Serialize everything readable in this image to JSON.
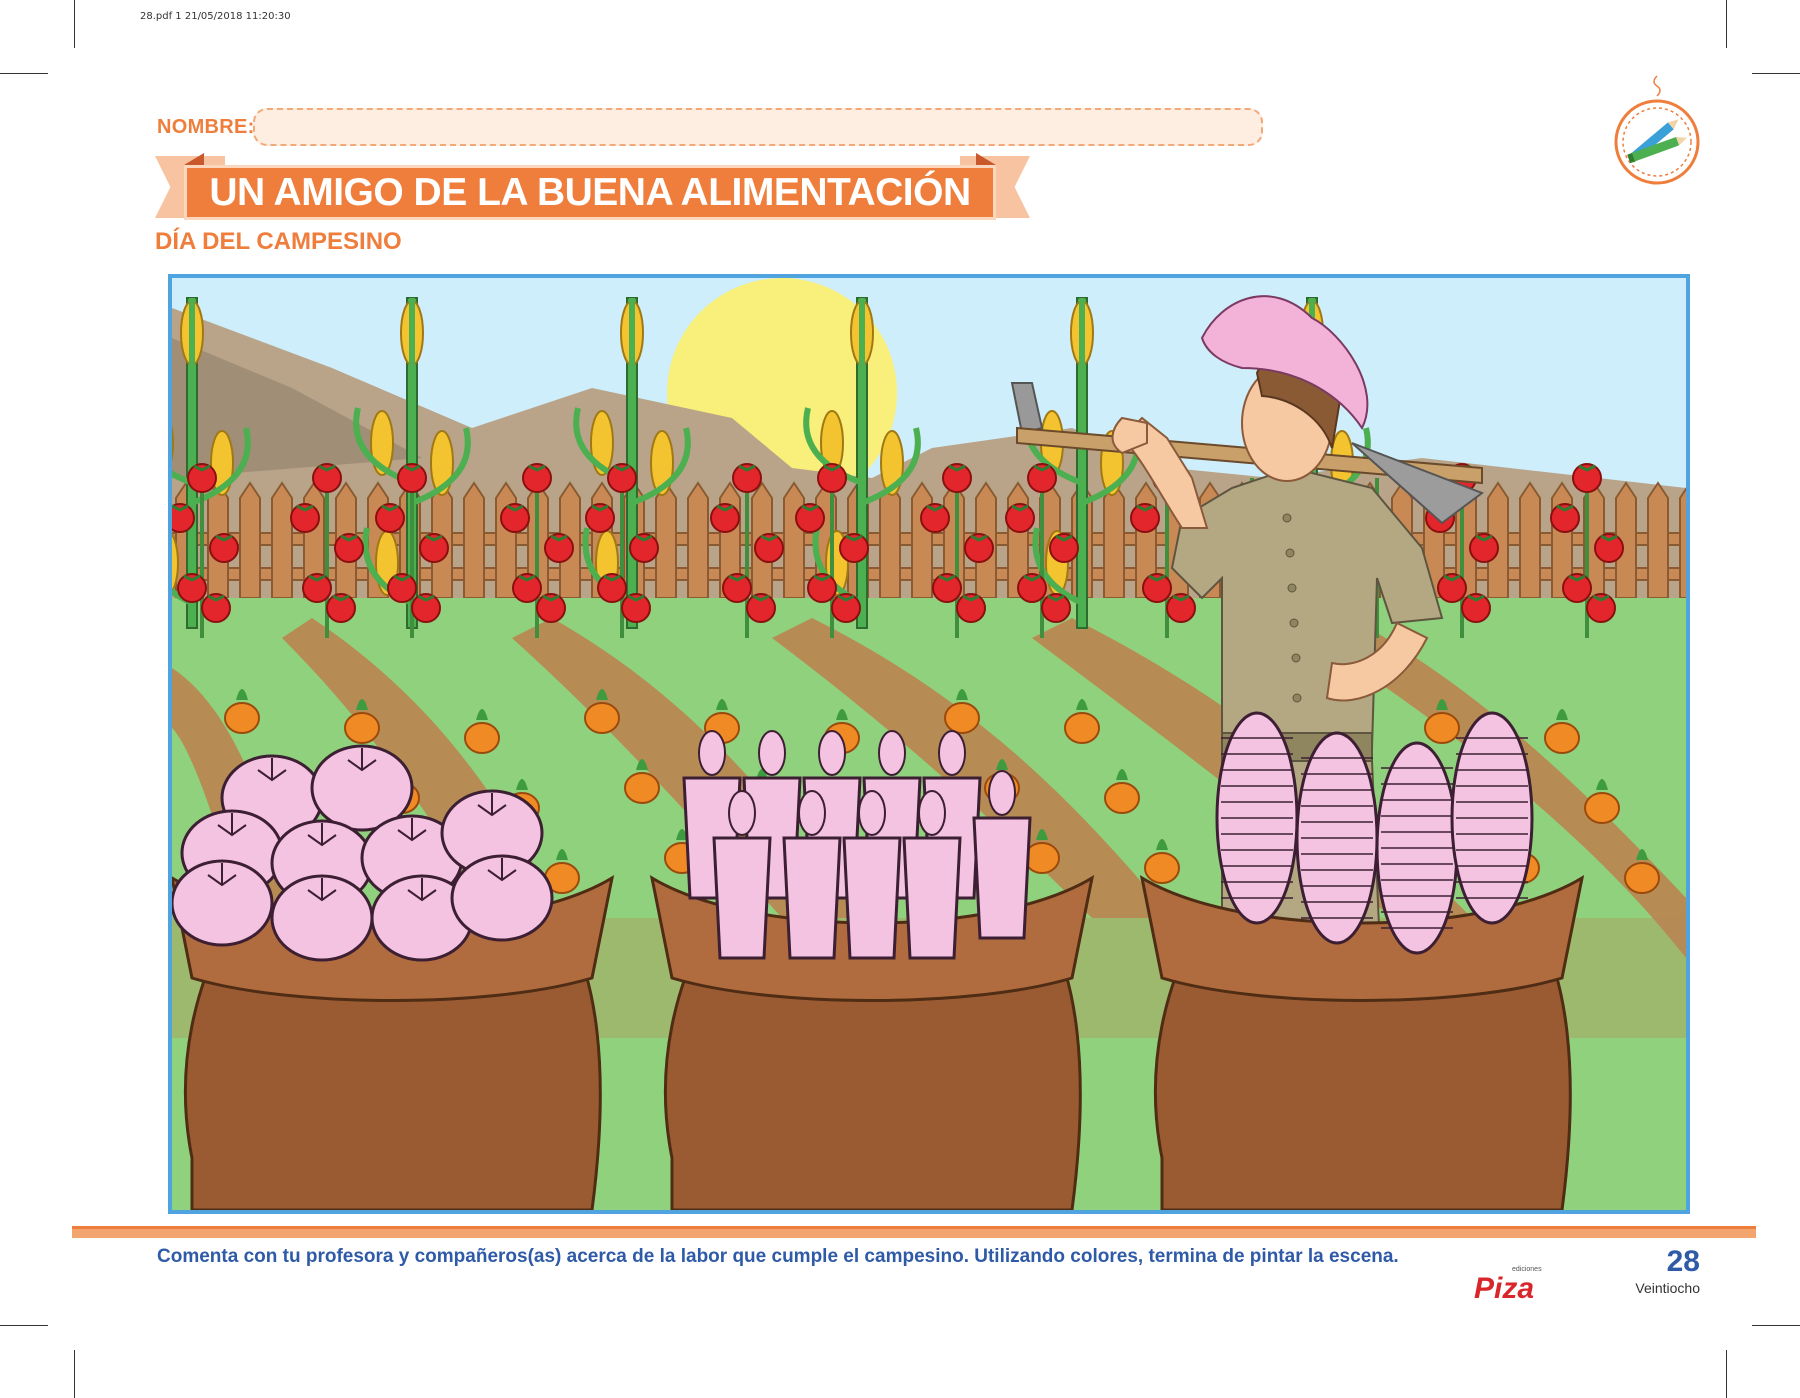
{
  "print_header": "28.pdf  1  21/05/2018  11:20:30",
  "nombre_label": "NOMBRE:",
  "title": "UN AMIGO DE LA BUENA ALIMENTACIÓN",
  "subtitle": "DÍA DEL CAMPESINO",
  "instruction": "Comenta con tu profesora y compañeros(as) acerca de la labor que cumple el campesino. Utilizando colores, termina de pintar la escena.",
  "logo": {
    "small_text": "ediciones",
    "brand": "Piza"
  },
  "page": {
    "number": "28",
    "word": "Veintiocho"
  },
  "colors": {
    "accent": "#ef7d3c",
    "blue": "#2f5aa8",
    "frame": "#4fa3df"
  },
  "icons": {
    "badge": "pencils-icon"
  },
  "scene": {
    "description_items": [
      "farmer",
      "corn-plants",
      "tomato-plants",
      "carrot-rows",
      "sack-of-tomatoes",
      "sack-of-carrots",
      "sack-of-corn",
      "mountains",
      "sun",
      "fence"
    ]
  }
}
